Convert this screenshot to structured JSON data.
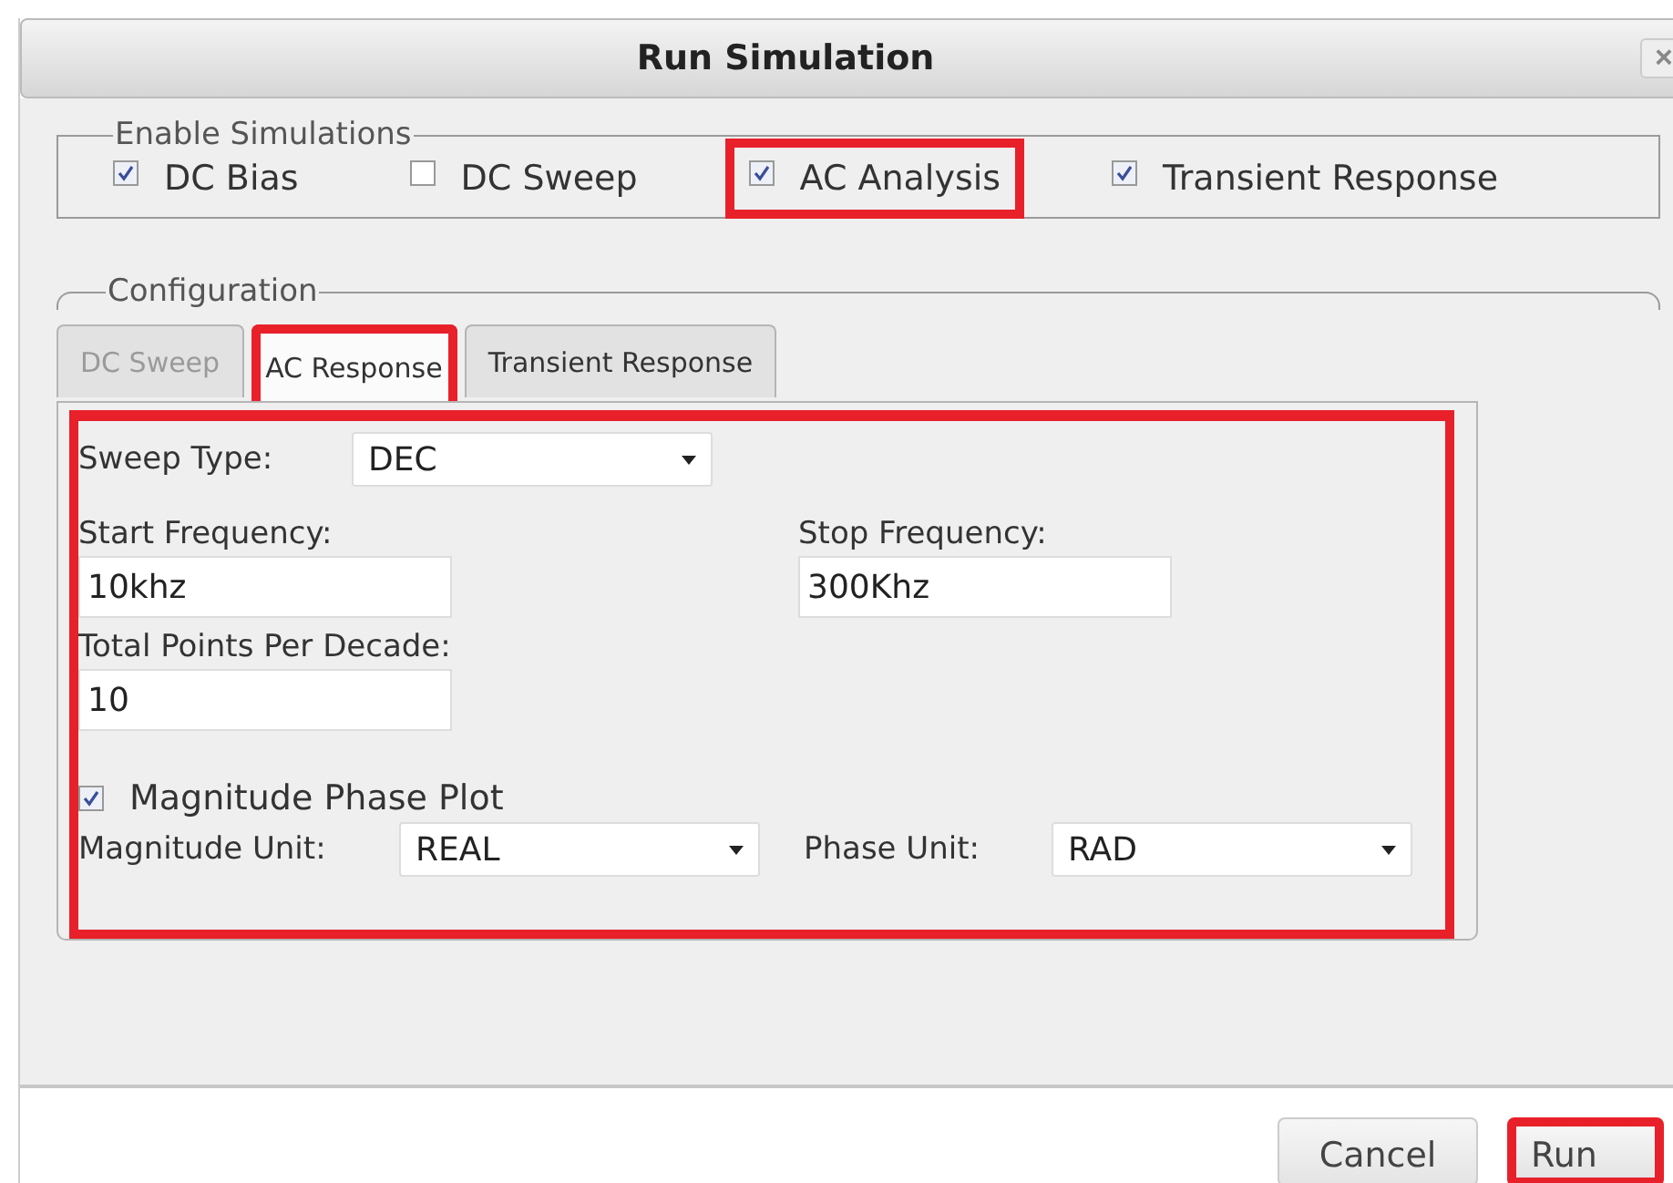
{
  "window": {
    "title": "Run Simulation",
    "close": "×"
  },
  "enable_simulations": {
    "legend": "Enable Simulations",
    "items": [
      {
        "label": "DC Bias",
        "checked": true,
        "highlighted": false
      },
      {
        "label": "DC Sweep",
        "checked": false,
        "highlighted": false
      },
      {
        "label": "AC Analysis",
        "checked": true,
        "highlighted": true
      },
      {
        "label": "Transient Response",
        "checked": true,
        "highlighted": false
      }
    ]
  },
  "configuration": {
    "legend": "Configuration",
    "tabs": [
      {
        "label": "DC Sweep",
        "selected": false,
        "disabled": true,
        "highlighted": false
      },
      {
        "label": "AC Response",
        "selected": true,
        "disabled": false,
        "highlighted": true
      },
      {
        "label": "Transient Response",
        "selected": false,
        "disabled": false,
        "highlighted": false
      }
    ],
    "panel_highlighted": true,
    "sweep_type": {
      "label": "Sweep Type:",
      "value": "DEC"
    },
    "start_frequency": {
      "label": "Start Frequency:",
      "value": "10khz"
    },
    "stop_frequency": {
      "label": "Stop Frequency:",
      "value": "300Khz"
    },
    "total_points": {
      "label": "Total Points Per Decade:",
      "value": "10"
    },
    "magnitude_phase_plot": {
      "label": "Magnitude Phase Plot",
      "checked": true
    },
    "magnitude_unit": {
      "label": "Magnitude Unit:",
      "value": "REAL"
    },
    "phase_unit": {
      "label": "Phase Unit:",
      "value": "RAD"
    }
  },
  "buttons": [
    {
      "label": "Cancel",
      "highlighted": false
    },
    {
      "label": "Run",
      "highlighted": true
    }
  ]
}
